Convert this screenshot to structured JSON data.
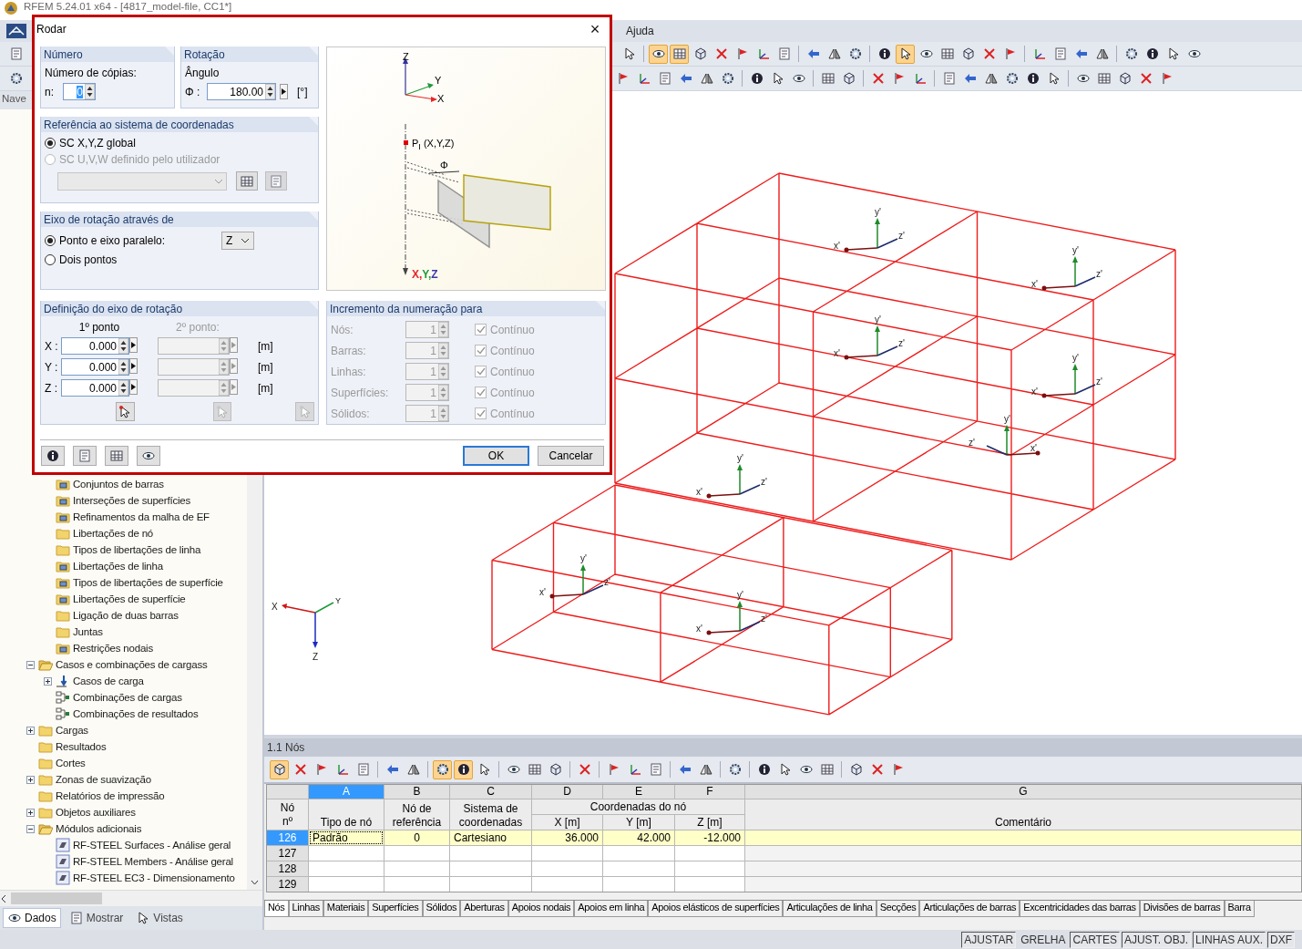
{
  "app": {
    "title": "RFEM 5.24.01 x64 - [4817_model-file, CC1*]",
    "menu": [
      {
        "label": "Ajuda"
      }
    ]
  },
  "toolbars": {
    "rows": [
      {
        "tools": [
          {
            "pressed": false
          },
          {
            "pressed": true
          },
          {
            "pressed": true
          },
          {
            "pressed": false
          },
          {
            "pressed": false
          },
          {
            "pressed": false
          },
          {
            "pressed": false
          },
          {
            "pressed": false
          },
          {
            "pressed": false
          },
          {
            "pressed": false
          },
          {
            "pressed": false
          },
          {
            "pressed": false
          },
          {
            "pressed": true
          },
          {
            "pressed": false
          },
          {
            "pressed": false
          },
          {
            "pressed": false
          },
          {
            "pressed": false
          },
          {
            "pressed": false
          },
          {
            "pressed": false
          },
          {
            "pressed": false
          },
          {
            "pressed": false
          },
          {
            "pressed": false
          },
          {
            "pressed": false
          },
          {
            "pressed": false
          },
          {
            "pressed": false
          },
          {
            "pressed": false
          }
        ]
      },
      {
        "tools": [
          {
            "pressed": false
          },
          {
            "pressed": false
          },
          {
            "pressed": false
          },
          {
            "pressed": false
          },
          {
            "pressed": false
          },
          {
            "pressed": false
          },
          {
            "pressed": false
          },
          {
            "pressed": false
          },
          {
            "pressed": false
          },
          {
            "pressed": false
          },
          {
            "pressed": false
          },
          {
            "pressed": false
          },
          {
            "pressed": false
          },
          {
            "pressed": false
          },
          {
            "pressed": false
          },
          {
            "pressed": false
          },
          {
            "pressed": false
          },
          {
            "pressed": false
          },
          {
            "pressed": false
          },
          {
            "pressed": false
          },
          {
            "pressed": false
          },
          {
            "pressed": false
          },
          {
            "pressed": false
          },
          {
            "pressed": false
          },
          {
            "pressed": false
          }
        ]
      }
    ]
  },
  "navigator": {
    "title": "Nave",
    "tree": [
      {
        "children": [
          {
            "children": [
              {
                "label": "Conjuntos de barras",
                "kind": "object"
              },
              {
                "label": "Interseções de superfícies",
                "kind": "object"
              },
              {
                "label": "Refinamentos da malha de EF",
                "kind": "object"
              },
              {
                "label": "Libertações de nó",
                "kind": "folder"
              },
              {
                "label": "Tipos de libertações de linha",
                "kind": "folder"
              },
              {
                "label": "Libertações de linha",
                "kind": "object"
              },
              {
                "label": "Tipos de libertações de superfície",
                "kind": "object"
              },
              {
                "label": "Libertações de superfície",
                "kind": "object"
              },
              {
                "label": "Ligação de duas barras",
                "kind": "folder"
              },
              {
                "label": "Juntas",
                "kind": "folder"
              },
              {
                "label": "Restrições nodais",
                "kind": "object"
              }
            ]
          },
          {
            "label": "Casos e combinações de cargass",
            "kind": "open-folder",
            "expanded": true,
            "children": [
              {
                "label": "Casos de carga",
                "kind": "load",
                "expanded": false
              },
              {
                "label": "Combinações de cargas",
                "kind": "combo"
              },
              {
                "label": "Combinações de resultados",
                "kind": "combo"
              }
            ]
          },
          {
            "label": "Cargas",
            "kind": "folder",
            "expanded": false
          },
          {
            "label": "Resultados",
            "kind": "folder"
          },
          {
            "label": "Cortes",
            "kind": "folder"
          },
          {
            "label": "Zonas de suavização",
            "kind": "folder",
            "expanded": false
          },
          {
            "label": "Relatórios de impressão",
            "kind": "folder"
          },
          {
            "label": "Objetos auxiliares",
            "kind": "folder",
            "expanded": false
          },
          {
            "label": "Módulos adicionais",
            "kind": "open-folder",
            "expanded": true,
            "children": [
              {
                "label": "RF-STEEL Surfaces - Análise geral",
                "kind": "module"
              },
              {
                "label": "RF-STEEL Members - Análise geral",
                "kind": "module"
              },
              {
                "label": "RF-STEEL EC3 - Dimensionamento",
                "kind": "module"
              }
            ]
          }
        ]
      }
    ],
    "tabs": [
      {
        "label": "Dados",
        "selected": true
      },
      {
        "label": "Mostrar",
        "selected": false
      },
      {
        "label": "Vistas",
        "selected": false
      }
    ]
  },
  "view": {
    "global_axes": {
      "x": "X",
      "y": "Y",
      "z": "Z"
    },
    "member_axes": [
      {
        "x": "x'",
        "y": "y'",
        "z": "z'"
      },
      {
        "x": "x'",
        "y": "y'",
        "z": "z'"
      },
      {
        "x": "x'",
        "y": "y'",
        "z": "z'"
      },
      {
        "x": "x'",
        "y": "y'",
        "z": "z'"
      },
      {
        "x": "x'",
        "y": "y'",
        "z": "z'"
      },
      {
        "x": "x'",
        "y": "y'",
        "z": "z'"
      },
      {
        "x": "x'",
        "y": "y'",
        "z": "z'"
      },
      {
        "x": "x'",
        "y": "y'",
        "z": "z'"
      }
    ]
  },
  "dialog": {
    "title": "Rodar",
    "close": "×",
    "number": {
      "title": "Número",
      "label": "Número de cópias:",
      "n_label": "n:",
      "value": "0"
    },
    "rotation": {
      "title": "Rotação",
      "label": "Ângulo",
      "phi_label": "Φ :",
      "value": "180.00",
      "unit": "[°]"
    },
    "reference": {
      "title": "Referência ao sistema de coordenadas",
      "options": [
        {
          "label": "SC X,Y,Z global",
          "selected": true,
          "disabled": false
        },
        {
          "label": "SC U,V,W definido pelo utilizador",
          "selected": false,
          "disabled": true
        }
      ],
      "buttons": [
        {
          "disabled": false
        },
        {
          "disabled": true
        }
      ]
    },
    "axis": {
      "title": "Eixo de rotação através de",
      "options": [
        {
          "label": "Ponto e eixo paralelo:",
          "selected": true
        },
        {
          "label": "Dois pontos",
          "selected": false
        }
      ],
      "axis_value": "Z"
    },
    "illustration": {
      "z": "Z",
      "y": "Y",
      "x": "X",
      "point": "P$_{I}$ (X,Y,Z)",
      "angle": "Φ",
      "axis_parts": [
        {
          "text": "X,",
          "color": "#e8262a"
        },
        {
          "text": "Y,",
          "color": "#1f9a3a"
        },
        {
          "text": "Z",
          "color": "#3a3aa8"
        }
      ]
    },
    "definition": {
      "title": "Definição do eixo de rotação",
      "first": "1º ponto",
      "second": "2º ponto:",
      "second_disabled": true,
      "rows": [
        {
          "label": "X :",
          "value": "0.000",
          "unit": "[m]"
        },
        {
          "label": "Y :",
          "value": "0.000",
          "unit": "[m]"
        },
        {
          "label": "Z :",
          "value": "0.000",
          "unit": "[m]"
        }
      ],
      "pick_buttons": [
        {
          "disabled": false
        },
        {
          "disabled": true
        },
        {
          "disabled": true
        }
      ]
    },
    "increment": {
      "title": "Incremento da numeração para",
      "rows": [
        {
          "label": "Nós:",
          "value": "1",
          "check": "Contínuo",
          "checked": true,
          "disabled": true
        },
        {
          "label": "Barras:",
          "value": "1",
          "check": "Contínuo",
          "checked": true,
          "disabled": true
        },
        {
          "label": "Linhas:",
          "value": "1",
          "check": "Contínuo",
          "checked": true,
          "disabled": true
        },
        {
          "label": "Superfícies:",
          "value": "1",
          "check": "Contínuo",
          "checked": true,
          "disabled": true
        },
        {
          "label": "Sólidos:",
          "value": "1",
          "check": "Contínuo",
          "checked": true,
          "disabled": true
        }
      ]
    },
    "ok": "OK",
    "cancel": "Cancelar"
  },
  "table": {
    "title": "1.1 Nós",
    "toolbar": [
      {
        "pressed": true
      },
      {
        "pressed": false
      },
      {
        "pressed": false
      },
      {
        "pressed": false
      },
      {
        "pressed": false
      },
      {
        "pressed": false
      },
      {
        "pressed": false
      },
      {
        "pressed": true
      },
      {
        "pressed": true
      },
      {
        "pressed": false
      },
      {
        "pressed": false
      },
      {
        "pressed": false
      },
      {
        "pressed": false
      },
      {
        "pressed": false
      },
      {
        "pressed": false
      },
      {
        "pressed": false
      },
      {
        "pressed": false
      },
      {
        "pressed": false
      },
      {
        "pressed": false
      },
      {
        "pressed": false
      },
      {
        "pressed": false
      },
      {
        "pressed": false
      },
      {
        "pressed": false
      },
      {
        "pressed": false
      },
      {
        "pressed": false
      },
      {
        "pressed": false
      },
      {
        "pressed": false
      }
    ],
    "row_header": [
      "Nó",
      "nº"
    ],
    "group_header": "Coordenadas do nó",
    "columns": [
      {
        "letter": "A",
        "header": [
          "Tipo de nó"
        ],
        "selected": true
      },
      {
        "letter": "B",
        "header": [
          "Nó de",
          "referência"
        ],
        "selected": false
      },
      {
        "letter": "C",
        "header": [
          "Sistema de",
          "coordenadas"
        ],
        "selected": false
      },
      {
        "letter": "D",
        "header": [
          "X [m]"
        ],
        "selected": false
      },
      {
        "letter": "E",
        "header": [
          "Y [m]"
        ],
        "selected": false
      },
      {
        "letter": "F",
        "header": [
          "Z [m]"
        ],
        "selected": false
      },
      {
        "letter": "G",
        "header": [
          "Comentário"
        ],
        "selected": false
      }
    ],
    "rows": [
      {
        "number": "126",
        "selected": true,
        "cells": [
          "Padrão",
          "0",
          "Cartesiano",
          "36.000",
          "42.000",
          "-12.000"
        ]
      },
      {
        "number": "127",
        "selected": false
      },
      {
        "number": "128",
        "selected": false
      },
      {
        "number": "129",
        "selected": false
      }
    ],
    "tabs": [
      {
        "label": "Nós",
        "selected": true
      },
      {
        "label": "Linhas",
        "selected": false
      },
      {
        "label": "Materiais",
        "selected": false
      },
      {
        "label": "Superfícies",
        "selected": false
      },
      {
        "label": "Sólidos",
        "selected": false
      },
      {
        "label": "Aberturas",
        "selected": false
      },
      {
        "label": "Apoios nodais",
        "selected": false
      },
      {
        "label": "Apoios em linha",
        "selected": false
      },
      {
        "label": "Apoios elásticos de superfícies",
        "selected": false
      },
      {
        "label": "Articulações de linha",
        "selected": false
      },
      {
        "label": "Secções",
        "selected": false
      },
      {
        "label": "Articulações de barras",
        "selected": false
      },
      {
        "label": "Excentricidades das barras",
        "selected": false
      },
      {
        "label": "Divisões de barras",
        "selected": false
      },
      {
        "label": "Barra",
        "selected": false
      }
    ]
  },
  "status_bar": [
    {
      "label": "AJUSTAR",
      "on": true
    },
    {
      "label": "GRELHA",
      "on": false
    },
    {
      "label": "CARTES",
      "on": true
    },
    {
      "label": "AJUST. OBJ.",
      "on": true
    },
    {
      "label": "LINHAS AUX.",
      "on": true
    },
    {
      "label": "DXF",
      "on": true
    }
  ]
}
